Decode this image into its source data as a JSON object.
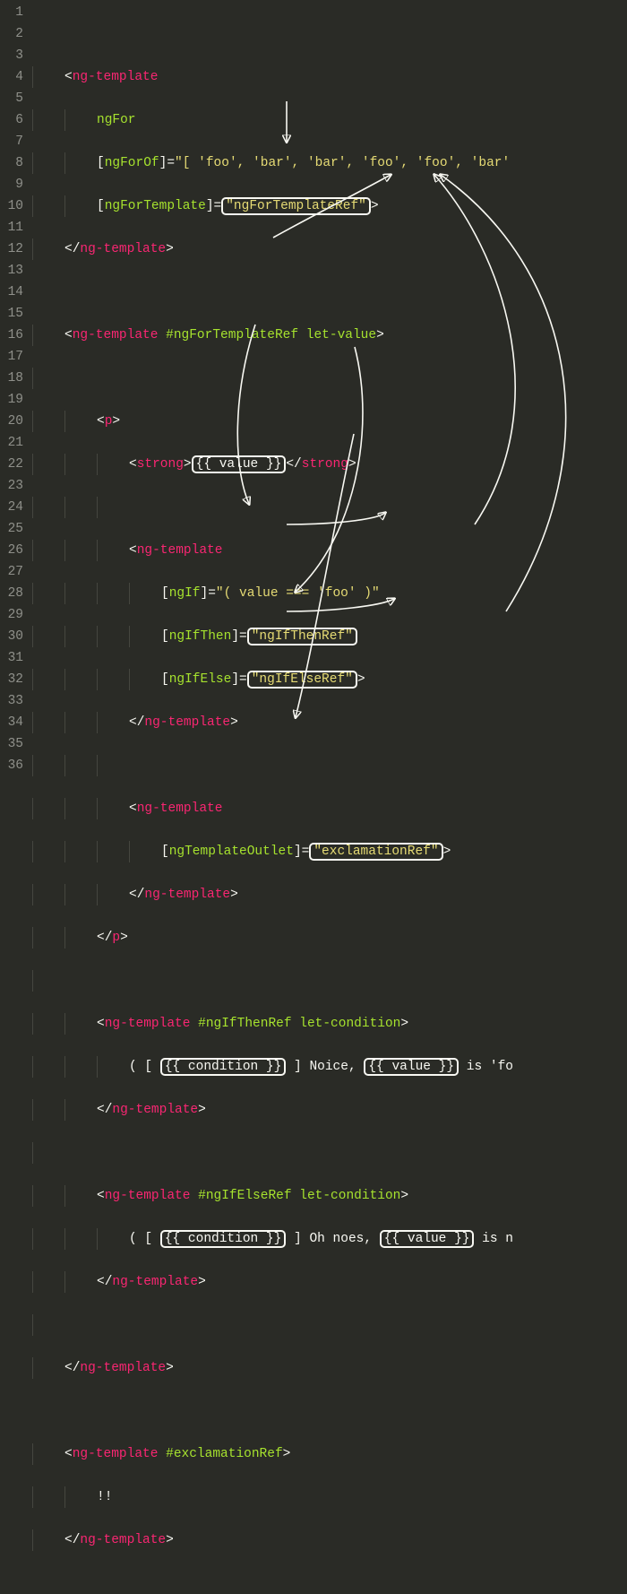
{
  "lineNumbers": [
    "1",
    "2",
    "3",
    "4",
    "5",
    "6",
    "7",
    "8",
    "9",
    "10",
    "11",
    "12",
    "13",
    "14",
    "15",
    "16",
    "17",
    "18",
    "19",
    "20",
    "21",
    "22",
    "23",
    "24",
    "25",
    "26",
    "27",
    "28",
    "29",
    "30",
    "31",
    "32",
    "33",
    "34",
    "35",
    "36"
  ],
  "code": {
    "l2": {
      "open": "<",
      "tag": "ng-template"
    },
    "l3": {
      "attr": "ngFor"
    },
    "l4": {
      "open": "[",
      "attr": "ngForOf",
      "close": "]",
      "eq": "=",
      "str": "\"[ 'foo', 'bar', 'bar', 'foo', 'foo', 'bar'"
    },
    "l5": {
      "open": "[",
      "attr": "ngForTemplate",
      "close": "]",
      "eq": "=",
      "str": "\"ngForTemplateRef\"",
      "end": ">"
    },
    "l6": {
      "open": "</",
      "tag": "ng-template",
      "end": ">"
    },
    "l8": {
      "open": "<",
      "tag": "ng-template",
      "sp": " ",
      "ref": "#ngForTemplateRef",
      "sp2": " ",
      "attr": "let-value",
      "end": ">"
    },
    "l10": {
      "open": "<",
      "tag": "p",
      "end": ">"
    },
    "l11": {
      "o1": "<",
      "t1": "strong",
      "c1": ">",
      "val": "{{ value }}",
      "o2": "</",
      "t2": "strong",
      "c2": ">"
    },
    "l13": {
      "open": "<",
      "tag": "ng-template"
    },
    "l14": {
      "open": "[",
      "attr": "ngIf",
      "close": "]",
      "eq": "=",
      "str": "\"( value === 'foo' )\""
    },
    "l15": {
      "open": "[",
      "attr": "ngIfThen",
      "close": "]",
      "eq": "=",
      "str": "\"ngIfThenRef\""
    },
    "l16": {
      "open": "[",
      "attr": "ngIfElse",
      "close": "]",
      "eq": "=",
      "str": "\"ngIfElseRef\"",
      "end": ">"
    },
    "l17": {
      "open": "</",
      "tag": "ng-template",
      "end": ">"
    },
    "l19": {
      "open": "<",
      "tag": "ng-template"
    },
    "l20": {
      "open": "[",
      "attr": "ngTemplateOutlet",
      "close": "]",
      "eq": "=",
      "str": "\"exclamationRef\"",
      "end": ">"
    },
    "l21": {
      "open": "</",
      "tag": "ng-template",
      "end": ">"
    },
    "l22": {
      "open": "</",
      "tag": "p",
      "end": ">"
    },
    "l24": {
      "open": "<",
      "tag": "ng-template",
      "sp": " ",
      "ref": "#ngIfThenRef",
      "sp2": " ",
      "attr": "let-condition",
      "end": ">"
    },
    "l25": {
      "a": "( [ ",
      "cond": "{{ condition }}",
      "b": " ] Noice, ",
      "val": "{{ value }}",
      "c": " is 'fo"
    },
    "l26": {
      "open": "</",
      "tag": "ng-template",
      "end": ">"
    },
    "l28": {
      "open": "<",
      "tag": "ng-template",
      "sp": " ",
      "ref": "#ngIfElseRef",
      "sp2": " ",
      "attr": "let-condition",
      "end": ">"
    },
    "l29": {
      "a": "( [ ",
      "cond": "{{ condition }}",
      "b": " ] Oh noes, ",
      "val": "{{ value }}",
      "c": " is n"
    },
    "l30": {
      "open": "</",
      "tag": "ng-template",
      "end": ">"
    },
    "l32": {
      "open": "</",
      "tag": "ng-template",
      "end": ">"
    },
    "l34": {
      "open": "<",
      "tag": "ng-template",
      "sp": " ",
      "ref": "#exclamationRef",
      "end": ">"
    },
    "l35": {
      "text": "!!"
    },
    "l36": {
      "open": "</",
      "tag": "ng-template",
      "end": ">"
    }
  }
}
